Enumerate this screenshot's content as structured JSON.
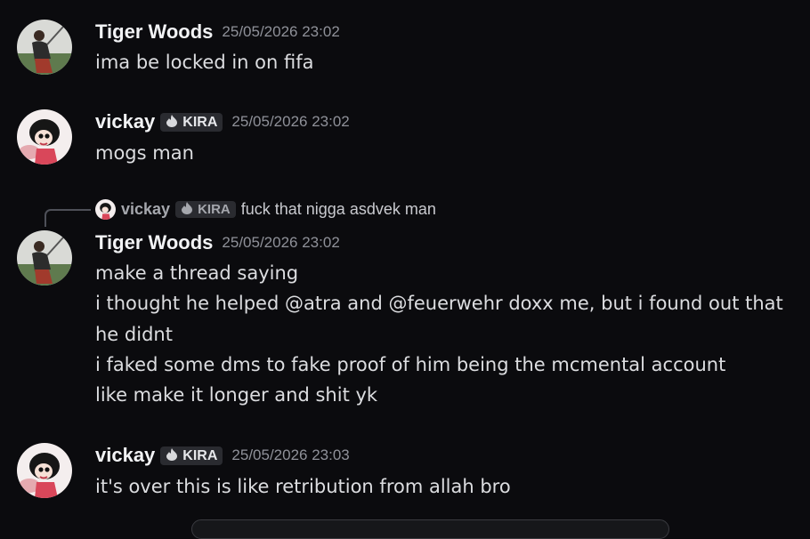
{
  "messages": [
    {
      "user": "Tiger Woods",
      "timestamp": "25/05/2026 23:02",
      "lines": [
        "ima be locked in on fifa"
      ]
    },
    {
      "user": "vickay",
      "tag": "KIRA",
      "timestamp": "25/05/2026 23:02",
      "lines": [
        "mogs man"
      ]
    },
    {
      "reply": {
        "user": "vickay",
        "tag": "KIRA",
        "text": "fuck that nigga asdvek man"
      },
      "user": "Tiger Woods",
      "timestamp": "25/05/2026 23:02",
      "lines": [
        "make a thread saying",
        "i thought he helped @atra and @feuerwehr doxx me, but i found out that",
        "he didnt",
        "i faked some dms to fake proof of him being the mcmental account",
        "like make it longer and shit yk"
      ]
    },
    {
      "user": "vickay",
      "tag": "KIRA",
      "timestamp": "25/05/2026 23:03",
      "lines": [
        "it's over this is like retribution from allah bro"
      ]
    }
  ],
  "icons": {
    "tag_icon": "flame-icon",
    "tiger_avatar": "golfer-avatar",
    "vickay_avatar": "cartoon-girl-avatar"
  },
  "colors": {
    "background": "#0b0b0e",
    "username": "#f2f3f5",
    "timestamp": "#8f9199",
    "tag_background": "#2a2b30"
  }
}
